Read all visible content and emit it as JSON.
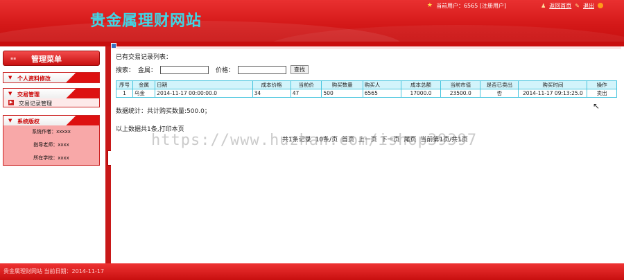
{
  "header": {
    "site_title": "贵金属理财网站",
    "current_user_text": "当前用户：6565 [注册用户]",
    "home_link": "返回首页",
    "logout_link": "退出"
  },
  "sidebar": {
    "menu_title": "管理菜单",
    "groups": [
      {
        "title": "个人资料修改",
        "items": []
      },
      {
        "title": "交易管理",
        "items": [
          {
            "label": "交易记录管理"
          }
        ]
      },
      {
        "title": "系统版权",
        "info": [
          {
            "label": "系统作者：xxxxx"
          },
          {
            "label": "指导老师：xxxx"
          },
          {
            "label": "所在学校：xxxx"
          }
        ]
      }
    ]
  },
  "main": {
    "list_title": "已有交易记录列表：",
    "search": {
      "label": "搜索：",
      "metal_label": "金属：",
      "metal_value": "",
      "price_label": "价格：",
      "price_value": "",
      "button": "查找"
    },
    "table": {
      "headers": [
        "序号",
        "金属",
        "日期",
        "成本价格",
        "当前价",
        "购买数量",
        "购买人",
        "成本总额",
        "当前市值",
        "是否已卖出",
        "购买时间",
        "操作"
      ],
      "rows": [
        [
          "1",
          "乌金",
          "2014-11-17 00:00:00.0",
          "34",
          "47",
          "500",
          "6565",
          "17000.0",
          "23500.0",
          "否",
          "2014-11-17 09:13:25.0",
          "卖出"
        ]
      ]
    },
    "stats": "数据统计：共计购买数量:500.0；",
    "print_line": "以上数据共1条,打印本页",
    "pager": "共1条记录  10条/页  首页  上一页  下一页  尾页  当前第1页/共1页"
  },
  "watermark": "https://www.huzhan.com/ishop39397",
  "footer": {
    "text": "贵金属理财网站 当前日期：2014-11-17"
  },
  "colors": {
    "header_red": "#d41818",
    "title_cyan": "#3fd6e6",
    "table_border": "#46c4de",
    "table_header_bg": "#d2f4fb"
  }
}
